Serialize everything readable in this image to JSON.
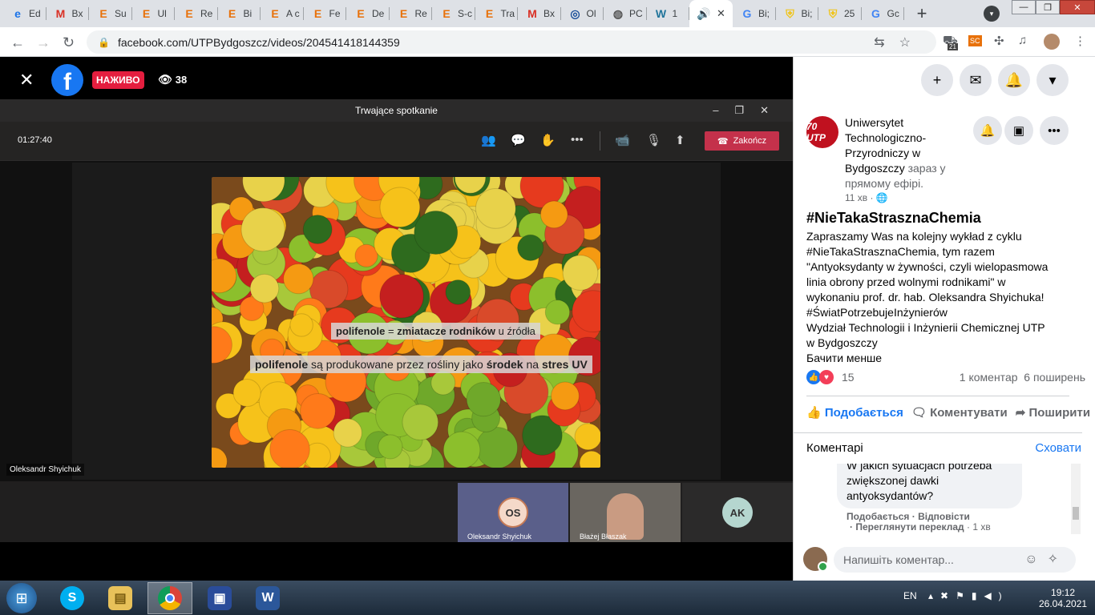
{
  "browser": {
    "tabs": [
      {
        "label": "Ed",
        "icon": "edge-icon"
      },
      {
        "label": "Bx",
        "icon": "gmail-icon"
      },
      {
        "label": "Su",
        "icon": "e-icon"
      },
      {
        "label": "Ul",
        "icon": "e-icon"
      },
      {
        "label": "Re",
        "icon": "e-icon"
      },
      {
        "label": "Bi",
        "icon": "e-icon"
      },
      {
        "label": "A c",
        "icon": "e-icon"
      },
      {
        "label": "Fe",
        "icon": "e-icon"
      },
      {
        "label": "De",
        "icon": "e-icon"
      },
      {
        "label": "Re",
        "icon": "e-icon"
      },
      {
        "label": "S-c",
        "icon": "e-icon"
      },
      {
        "label": "Tra",
        "icon": "e-icon"
      },
      {
        "label": "Bx",
        "icon": "gmail-icon"
      },
      {
        "label": "Ol",
        "icon": "uni-icon"
      },
      {
        "label": "PC",
        "icon": "globe-icon"
      },
      {
        "label": "1",
        "icon": "wordpress-icon"
      },
      {
        "label": "",
        "icon": "audio-icon"
      },
      {
        "label": "Bi;",
        "icon": "google-icon"
      },
      {
        "label": "Bi;",
        "icon": "shield-icon"
      },
      {
        "label": "25",
        "icon": "shield-icon"
      },
      {
        "label": "Gc",
        "icon": "translate-icon"
      }
    ],
    "url": "facebook.com/UTPBydgoszcz/videos/204541418144359",
    "ext_badge": "21"
  },
  "video": {
    "live_label": "НАЖИВО",
    "viewer_count": "38",
    "teams": {
      "window_title": "Trwające spotkanie",
      "timer": "01:27:40",
      "end_label": "Zakończ",
      "caption1": {
        "a": "polifenole",
        "b": " = ",
        "c": "zmiatacze rodników",
        "d": " u źródła"
      },
      "caption2": {
        "a": "polifenole",
        "b": " są produkowane przez rośliny jako ",
        "c": "środek",
        "d": " na ",
        "e": "stres UV"
      },
      "presenter_name": "Oleksandr Shyichuk",
      "participants": [
        {
          "initials": "OS",
          "name": "Oleksandr Shyichuk"
        },
        {
          "initials": "",
          "name": "Błażej Błaszak"
        },
        {
          "initials": "AK",
          "name": ""
        }
      ]
    }
  },
  "post": {
    "page_name": "Uniwersytet Technologiczno-Przyrodniczy w Bydgoszczy",
    "live_status": " зараз у прямому ефірі.",
    "time_ago": "11 хв · ",
    "logo_text": "70 UTP",
    "hashtag_title": "#NieTakaStrasznaChemia",
    "body_lines": [
      "Zapraszamy Was na kolejny wykład z cyklu",
      "#NieTakaStrasznaChemia, tym razem",
      "\"Antyoksydanty w żywności, czyli wielopasmowa",
      "linia obrony przed wolnymi rodnikami\" w",
      "wykonaniu prof. dr. hab. Oleksandra Shyichuka!",
      "#ŚwiatPotrzebujeInżynierów",
      "Wydział Technologii i Inżynierii Chemicznej UTP",
      "w Bydgoszczy"
    ],
    "see_less": "Бачити менше",
    "reaction_count": "15",
    "comments_count": "1 коментар",
    "shares_count": "6 поширень",
    "like_label": "Подобається",
    "comment_label": "Коментувати",
    "share_label": "Поширити",
    "comments_header": "Коментарі",
    "hide_label": "Сховати",
    "comment_text": [
      "W jakich sytuacjach potrzeba",
      "zwiększonej dawki",
      "antyoksydantów?"
    ],
    "comment_links": {
      "like": "Подобається",
      "reply": "Відповісти",
      "translate": "Переглянути переклад",
      "time": "1 хв"
    },
    "compose_placeholder": "Напишіть коментар..."
  },
  "taskbar": {
    "lang": "EN",
    "time": "19:12",
    "date": "26.04.2021"
  },
  "colors": {
    "fb_blue": "#1877f2",
    "live_red": "#e41e3f",
    "teams_end": "#c4314b"
  }
}
